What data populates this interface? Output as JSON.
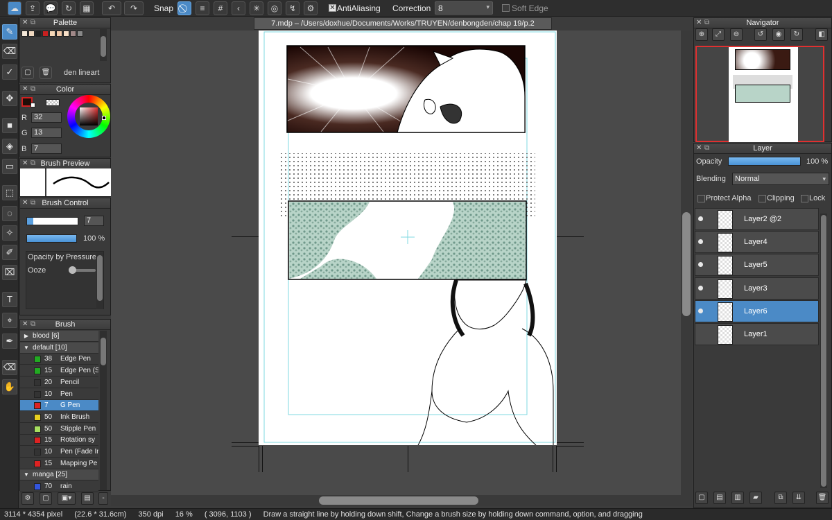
{
  "toolbar": {
    "snap_label": "Snap",
    "antialiasing_label": "AntiAliasing",
    "antialiasing_checked": true,
    "correction_label": "Correction",
    "correction_value": "8",
    "soft_edge_label": "Soft Edge",
    "soft_edge_checked": false
  },
  "document": {
    "title": "7.mdp – /Users/doxhue/Documents/Works/TRUYEN/denbongden/chap 19/p.2"
  },
  "palette": {
    "title": "Palette",
    "layer_name": "den lineart",
    "swatches": [
      "#f4e8d8",
      "#f0d8c0",
      "#222222",
      "#c82020",
      "#f6d8b8",
      "#f0c8a8",
      "#f8e0c8",
      "#a08888",
      "#888888"
    ]
  },
  "color": {
    "title": "Color",
    "r_label": "R",
    "r_value": "32",
    "g_label": "G",
    "g_value": "13",
    "b_label": "B",
    "b_value": "7",
    "current": "#200d07"
  },
  "brush_preview": {
    "title": "Brush Preview"
  },
  "brush_control": {
    "title": "Brush Control",
    "size_value": "7",
    "opacity_value": "100 %",
    "pressure_label": "Opacity by Pressure",
    "ooze_label": "Ooze"
  },
  "brush": {
    "title": "Brush",
    "rows": [
      {
        "kind": "group",
        "open": false,
        "label": "blood [6]"
      },
      {
        "kind": "group",
        "open": true,
        "label": "default [10]"
      },
      {
        "kind": "item",
        "color": "#22aa22",
        "size": "38",
        "name": "Edge Pen"
      },
      {
        "kind": "item",
        "color": "#22aa22",
        "size": "15",
        "name": "Edge Pen (S"
      },
      {
        "kind": "item",
        "color": "#333333",
        "size": "20",
        "name": "Pencil"
      },
      {
        "kind": "item",
        "color": "#333333",
        "size": "10",
        "name": "Pen"
      },
      {
        "kind": "item",
        "color": "#dd2222",
        "size": "7",
        "name": "G Pen",
        "selected": true
      },
      {
        "kind": "item",
        "color": "#e8d020",
        "size": "50",
        "name": "Ink Brush"
      },
      {
        "kind": "item",
        "color": "#a8e060",
        "size": "50",
        "name": "Stipple Pen"
      },
      {
        "kind": "item",
        "color": "#dd2222",
        "size": "15",
        "name": "Rotation sy"
      },
      {
        "kind": "item",
        "color": "#333333",
        "size": "10",
        "name": "Pen (Fade In"
      },
      {
        "kind": "item",
        "color": "#dd2222",
        "size": "15",
        "name": "Mapping Pe"
      },
      {
        "kind": "group",
        "open": true,
        "label": "manga [25]"
      },
      {
        "kind": "item",
        "color": "#3355dd",
        "size": "70",
        "name": "rain"
      }
    ]
  },
  "navigator": {
    "title": "Navigator"
  },
  "layer": {
    "title": "Layer",
    "opacity_label": "Opacity",
    "opacity_value": "100 %",
    "blending_label": "Blending",
    "blending_value": "Normal",
    "protect_alpha_label": "Protect Alpha",
    "clipping_label": "Clipping",
    "lock_label": "Lock",
    "rows": [
      {
        "name": "Layer2 @2",
        "visible": true,
        "selected": false
      },
      {
        "name": "Layer4",
        "visible": true,
        "selected": false
      },
      {
        "name": "Layer5",
        "visible": true,
        "selected": false
      },
      {
        "name": "Layer3",
        "visible": true,
        "selected": false
      },
      {
        "name": "Layer6",
        "visible": true,
        "selected": true
      },
      {
        "name": "Layer1",
        "visible": false,
        "selected": false
      }
    ]
  },
  "status": {
    "pixel_size": "3114 * 4354 pixel",
    "cm_size": "(22.6 * 31.6cm)",
    "dpi": "350 dpi",
    "zoom": "16 %",
    "cursor": "( 3096, 1103 )",
    "hint": "Draw a straight line by holding down shift, Change a brush size by holding down command, option, and dragging"
  }
}
